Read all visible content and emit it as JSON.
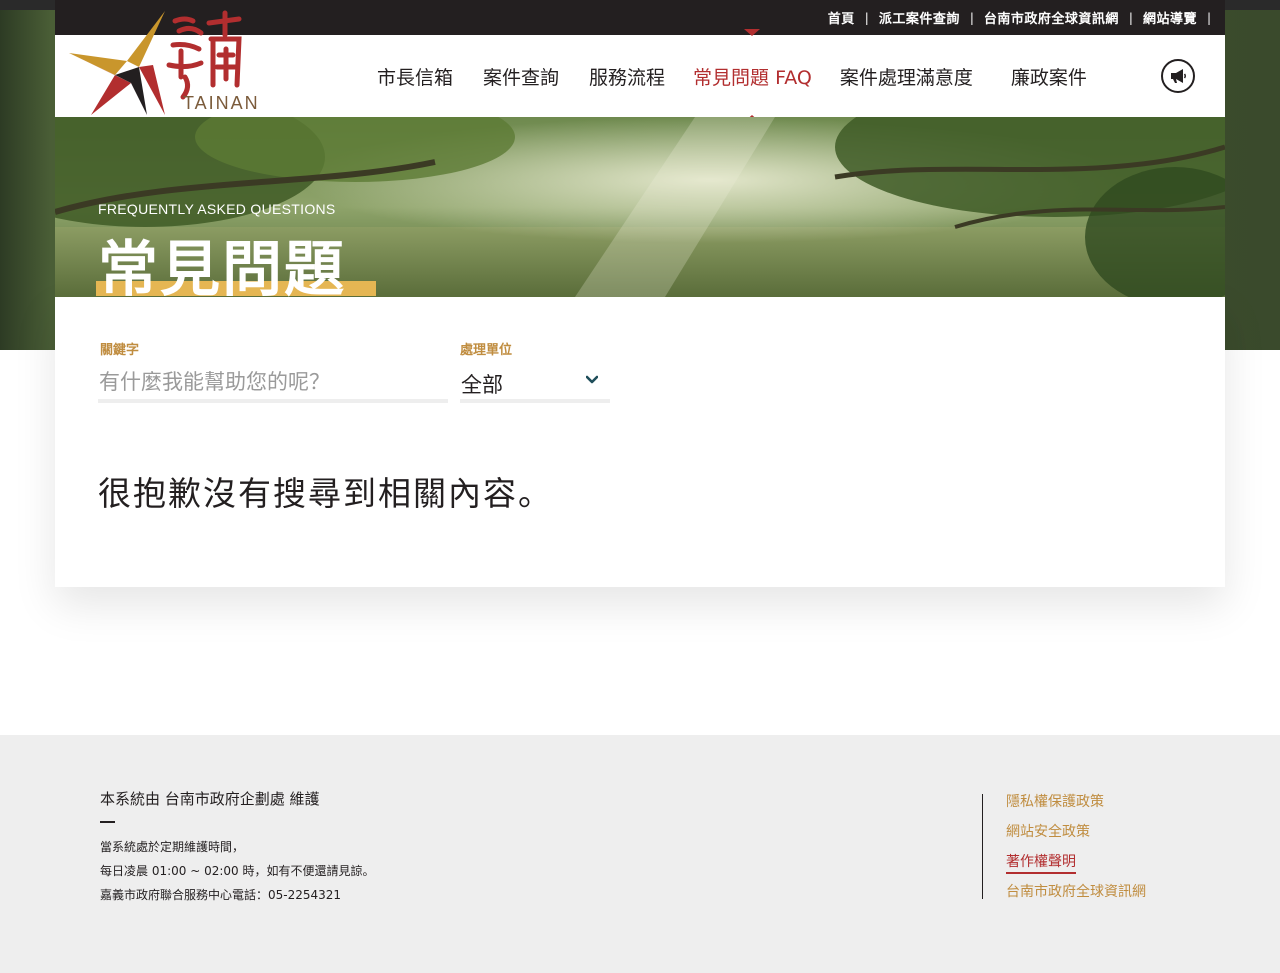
{
  "topbar": {
    "links": [
      "首頁",
      "派工案件查詢",
      "台南市政府全球資訊網",
      "網站導覽"
    ],
    "separator": "|"
  },
  "logo": {
    "text": "TAINAN"
  },
  "nav": {
    "items": [
      "市長信箱",
      "案件查詢",
      "服務流程",
      "常見問題 FAQ",
      "案件處理滿意度",
      "廉政案件"
    ],
    "active_index": 3,
    "announce_icon": "bullhorn-icon"
  },
  "banner": {
    "subtitle": "FREQUENTLY ASKED QUESTIONS",
    "title": "常見問題"
  },
  "search": {
    "keyword_label": "關鍵字",
    "keyword_placeholder": "有什麼我能幫助您的呢？",
    "keyword_value": "",
    "unit_label": "處理單位",
    "unit_value": "全部"
  },
  "result": {
    "message": "很抱歉沒有搜尋到相關內容。"
  },
  "footer": {
    "title": "本系統由 台南市政府企劃處 維護",
    "lines": [
      "當系統處於定期維護時間，",
      "每日凌晨 01:00 ~ 02:00 時，如有不便還請見諒。",
      "嘉義市政府聯合服務中心電話：05-2254321"
    ],
    "links": [
      "隱私權保護政策",
      "網站安全政策",
      "著作權聲明",
      "台南市政府全球資訊網"
    ],
    "current_link_index": 2
  },
  "colors": {
    "accent_red": "#b22e2f",
    "accent_gold": "#c08d40",
    "highlight_yellow": "#e5b653",
    "dark": "#231f20",
    "footer_bg": "#eeeeee"
  }
}
